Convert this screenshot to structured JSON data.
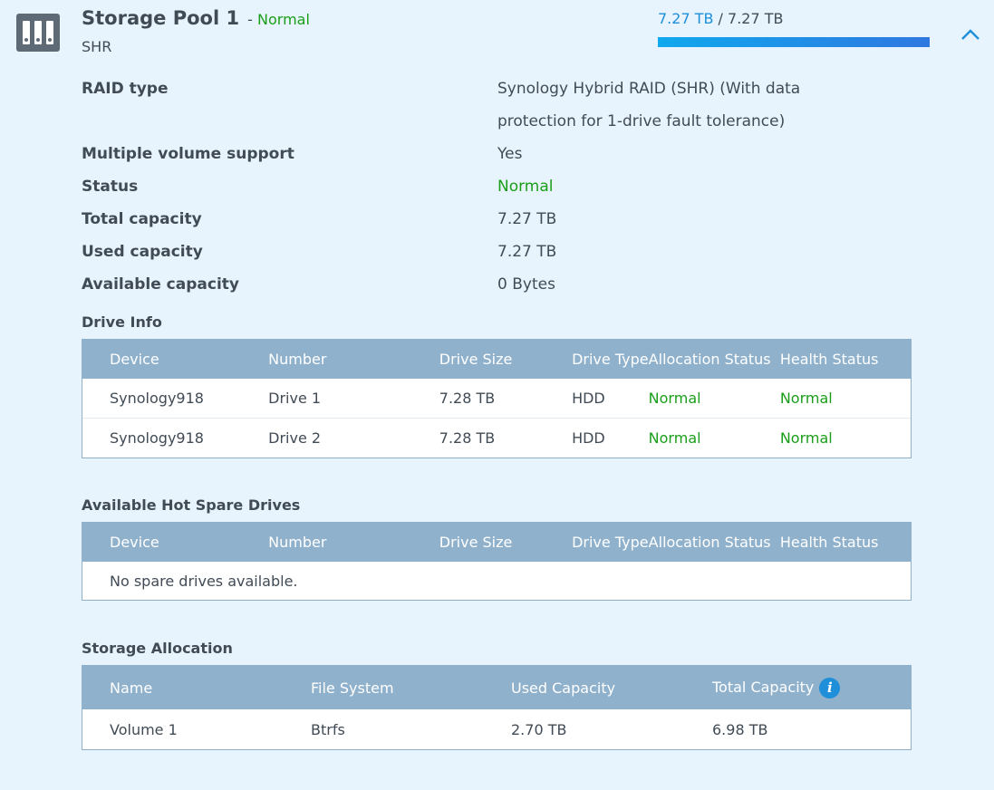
{
  "pool": {
    "icon": "storage-pool-icon",
    "name": "Storage Pool 1",
    "separator": " - ",
    "status": "Normal",
    "raid_short": "SHR",
    "usage_used": "7.27 TB",
    "usage_sep": " / ",
    "usage_total": "7.27 TB",
    "usage_fraction": 1.0,
    "collapse_icon": "chevron-up-icon"
  },
  "properties": [
    {
      "label": "RAID type",
      "value_line1": "Synology Hybrid RAID (SHR) (With data",
      "value_line2": "protection for 1-drive fault tolerance)"
    },
    {
      "label": "Multiple volume support",
      "value": "Yes"
    },
    {
      "label": "Status",
      "value": "Normal"
    },
    {
      "label": "Total capacity",
      "value": "7.27 TB"
    },
    {
      "label": "Used capacity",
      "value": "7.27 TB"
    },
    {
      "label": "Available capacity",
      "value": "0 Bytes"
    }
  ],
  "drive_info": {
    "title": "Drive Info",
    "columns": [
      "Device",
      "Number",
      "Drive Size",
      "Drive Type",
      "Allocation Status",
      "Health Status"
    ],
    "rows": [
      [
        "Synology918",
        "Drive 1",
        "7.28 TB",
        "HDD",
        "Normal",
        "Normal"
      ],
      [
        "Synology918",
        "Drive 2",
        "7.28 TB",
        "HDD",
        "Normal",
        "Normal"
      ]
    ]
  },
  "hot_spare": {
    "title": "Available Hot Spare Drives",
    "columns": [
      "Device",
      "Number",
      "Drive Size",
      "Drive Type",
      "Allocation Status",
      "Health Status"
    ],
    "empty_text": "No spare drives available."
  },
  "allocation": {
    "title": "Storage Allocation",
    "columns": [
      "Name",
      "File System",
      "Used Capacity",
      "Total Capacity"
    ],
    "info_icon": "info-icon",
    "rows": [
      [
        "Volume 1",
        "Btrfs",
        "2.70 TB",
        "6.98 TB"
      ]
    ]
  },
  "colors": {
    "background": "#e8f4fd",
    "header": "#8fb1cc",
    "status_green": "#1a9e1a",
    "accent_blue": "#1e8fd8"
  }
}
